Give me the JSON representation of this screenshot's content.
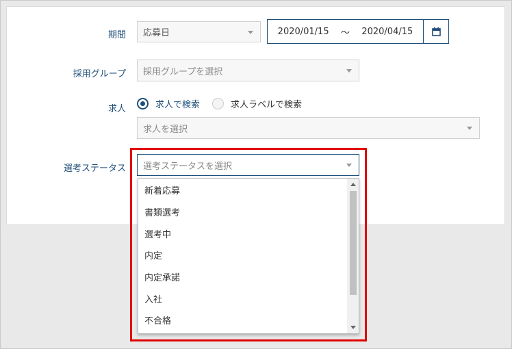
{
  "form": {
    "period": {
      "label": "期間",
      "type_value": "応募日",
      "date_from": "2020/01/15",
      "separator": "〜",
      "date_to": "2020/04/15",
      "calendar_icon": "calendar-icon"
    },
    "group": {
      "label": "採用グループ",
      "placeholder": "採用グループを選択"
    },
    "job": {
      "label": "求人",
      "radio_1": "求人で検索",
      "radio_2": "求人ラベルで検索",
      "selected_radio": 1,
      "placeholder": "求人を選択"
    },
    "status": {
      "label": "選考ステータス",
      "placeholder": "選考ステータスを選択",
      "options": [
        "新着応募",
        "書類選考",
        "選考中",
        "内定",
        "内定承諾",
        "入社",
        "不合格"
      ]
    }
  },
  "colors": {
    "accent": "#1f4e79",
    "highlight": "#e00000"
  }
}
